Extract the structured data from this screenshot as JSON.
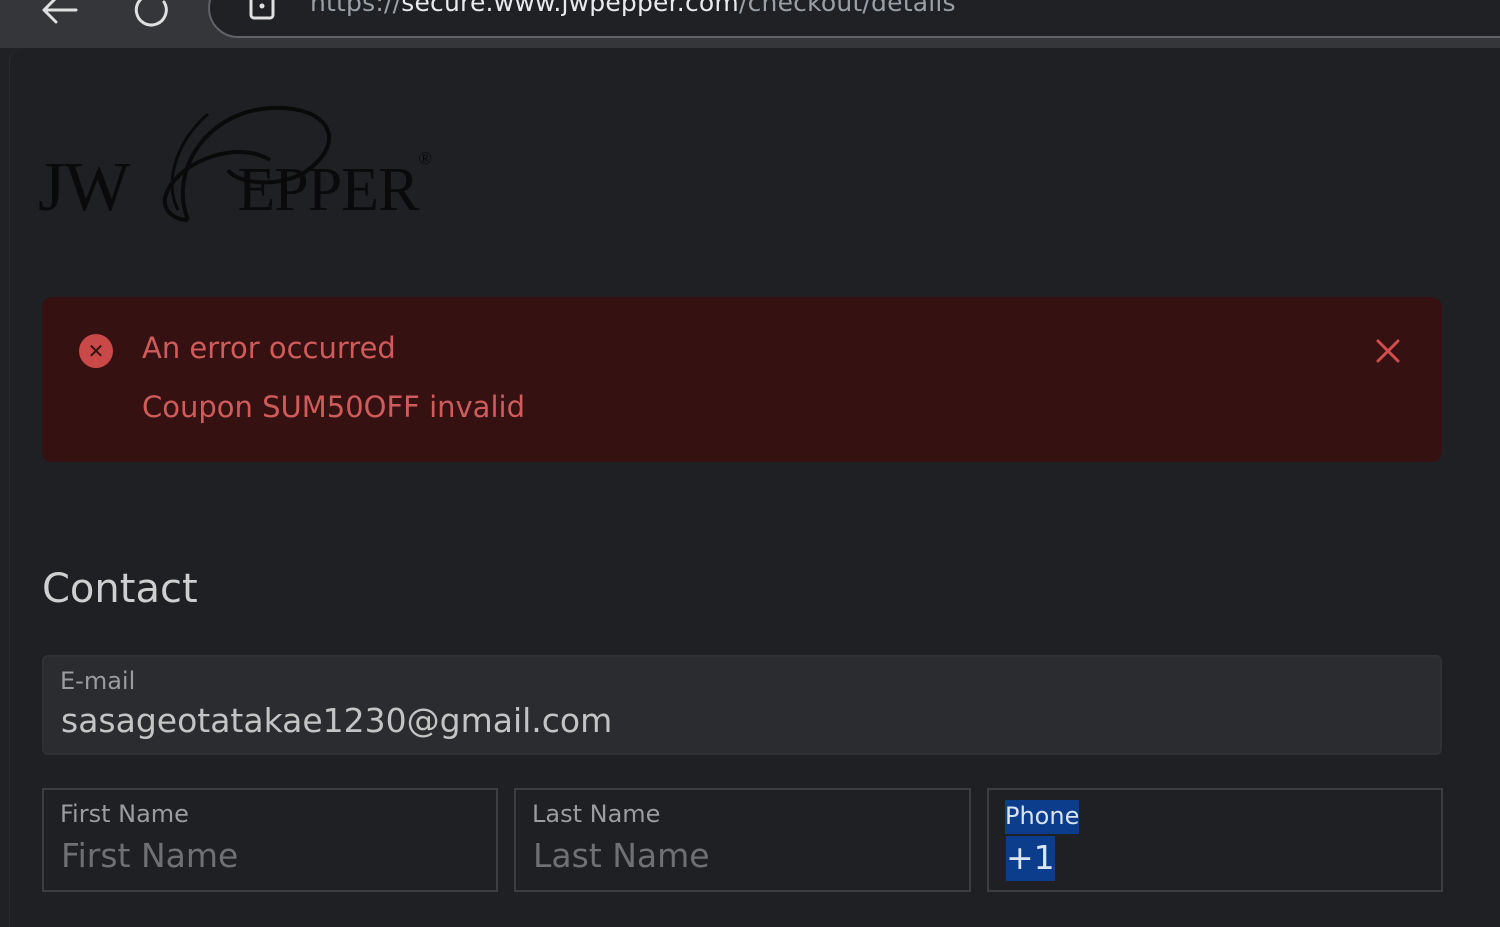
{
  "browser": {
    "url_scheme": "https://",
    "url_host": "secure.www.jwpepper.com",
    "url_path": "/checkout/details"
  },
  "logo": {
    "text_pre": "JW",
    "text_post": "EPPER",
    "mark": "®"
  },
  "alert": {
    "title": "An error occurred",
    "message": "Coupon SUM50OFF invalid"
  },
  "contact": {
    "heading": "Contact",
    "email": {
      "label": "E-mail",
      "value": "sasageotatakae1230@gmail.com"
    },
    "first_name": {
      "label": "First Name",
      "placeholder": "First Name"
    },
    "last_name": {
      "label": "Last Name",
      "placeholder": "Last Name"
    },
    "phone": {
      "label": "Phone",
      "value": "+1"
    }
  },
  "colors": {
    "alert_bg": "#361112",
    "alert_text": "#cf5b5b",
    "selection": "#0b3d8c"
  },
  "icons": {
    "back": "arrow-left-icon",
    "reload": "reload-icon",
    "site_info": "site-info-icon",
    "alert": "error-circle-icon",
    "close": "close-icon"
  }
}
